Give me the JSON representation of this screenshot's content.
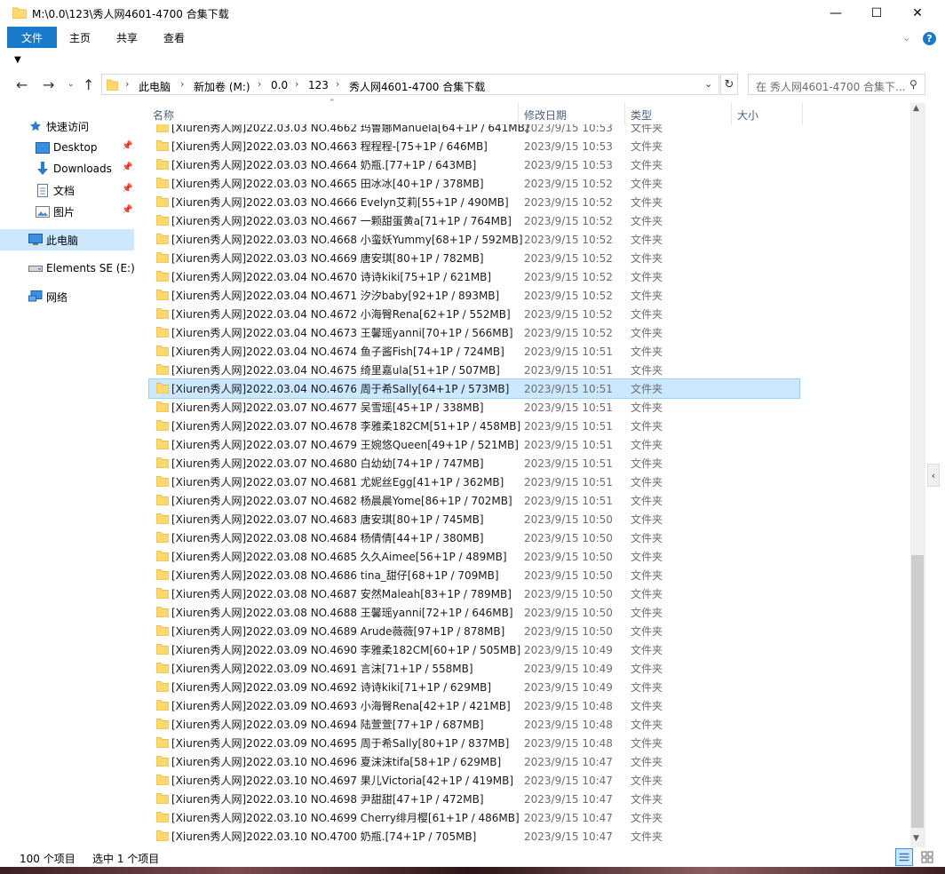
{
  "window": {
    "title": "M:\\0.0\\123\\秀人网4601-4700 合集下载",
    "minimize_glyph": "—",
    "maximize_glyph": "☐",
    "close_glyph": "✕"
  },
  "ribbon": {
    "tabs": [
      "文件",
      "主页",
      "共享",
      "查看"
    ],
    "help": "?"
  },
  "address": {
    "crumbs": [
      "此电脑",
      "新加卷 (M:)",
      "0.0",
      "123",
      "秀人网4601-4700 合集下载"
    ],
    "separator": "›"
  },
  "search": {
    "placeholder": "在 秀人网4601-4700 合集下..."
  },
  "nav": {
    "quick_access": "快速访问",
    "desktop": "Desktop",
    "downloads": "Downloads",
    "documents": "文档",
    "pictures": "图片",
    "this_pc": "此电脑",
    "elements": "Elements SE (E:)",
    "network": "网络"
  },
  "columns": {
    "name": "名称",
    "date": "修改日期",
    "type": "类型",
    "size": "大小"
  },
  "files": [
    {
      "name": "[Xiuren秀人网]2022.03.03 NO.4662 玛鲁娜Manuela[64+1P / 641MB]",
      "date": "2023/9/15 10:53",
      "type": "文件夹"
    },
    {
      "name": "[Xiuren秀人网]2022.03.03 NO.4663 程程程-[75+1P / 646MB]",
      "date": "2023/9/15 10:53",
      "type": "文件夹"
    },
    {
      "name": "[Xiuren秀人网]2022.03.03 NO.4664 奶瓶.[77+1P / 643MB]",
      "date": "2023/9/15 10:53",
      "type": "文件夹"
    },
    {
      "name": "[Xiuren秀人网]2022.03.03 NO.4665 田冰冰[40+1P / 378MB]",
      "date": "2023/9/15 10:52",
      "type": "文件夹"
    },
    {
      "name": "[Xiuren秀人网]2022.03.03 NO.4666 Evelyn艾莉[55+1P / 490MB]",
      "date": "2023/9/15 10:52",
      "type": "文件夹"
    },
    {
      "name": "[Xiuren秀人网]2022.03.03 NO.4667 一颗甜蛋黄a[71+1P / 764MB]",
      "date": "2023/9/15 10:52",
      "type": "文件夹"
    },
    {
      "name": "[Xiuren秀人网]2022.03.03 NO.4668 小蛮妖Yummy[68+1P / 592MB]",
      "date": "2023/9/15 10:52",
      "type": "文件夹"
    },
    {
      "name": "[Xiuren秀人网]2022.03.03 NO.4669 唐安琪[80+1P / 782MB]",
      "date": "2023/9/15 10:52",
      "type": "文件夹"
    },
    {
      "name": "[Xiuren秀人网]2022.03.04 NO.4670 诗诗kiki[75+1P / 621MB]",
      "date": "2023/9/15 10:52",
      "type": "文件夹"
    },
    {
      "name": "[Xiuren秀人网]2022.03.04 NO.4671 汐汐baby[92+1P / 893MB]",
      "date": "2023/9/15 10:52",
      "type": "文件夹"
    },
    {
      "name": "[Xiuren秀人网]2022.03.04 NO.4672 小海臀Rena[62+1P / 552MB]",
      "date": "2023/9/15 10:52",
      "type": "文件夹"
    },
    {
      "name": "[Xiuren秀人网]2022.03.04 NO.4673 王馨瑶yanni[70+1P / 566MB]",
      "date": "2023/9/15 10:52",
      "type": "文件夹"
    },
    {
      "name": "[Xiuren秀人网]2022.03.04 NO.4674 鱼子酱Fish[74+1P / 724MB]",
      "date": "2023/9/15 10:51",
      "type": "文件夹"
    },
    {
      "name": "[Xiuren秀人网]2022.03.04 NO.4675 绮里嘉ula[51+1P / 507MB]",
      "date": "2023/9/15 10:51",
      "type": "文件夹"
    },
    {
      "name": "[Xiuren秀人网]2022.03.04 NO.4676 周于希Sally[64+1P / 573MB]",
      "date": "2023/9/15 10:51",
      "type": "文件夹",
      "selected": true
    },
    {
      "name": "[Xiuren秀人网]2022.03.07 NO.4677 吴雪瑶[45+1P / 338MB]",
      "date": "2023/9/15 10:51",
      "type": "文件夹"
    },
    {
      "name": "[Xiuren秀人网]2022.03.07 NO.4678 李雅柔182CM[51+1P / 458MB]",
      "date": "2023/9/15 10:51",
      "type": "文件夹"
    },
    {
      "name": "[Xiuren秀人网]2022.03.07 NO.4679 王婉悠Queen[49+1P / 521MB]",
      "date": "2023/9/15 10:51",
      "type": "文件夹"
    },
    {
      "name": "[Xiuren秀人网]2022.03.07 NO.4680 白幼幼[74+1P / 747MB]",
      "date": "2023/9/15 10:51",
      "type": "文件夹"
    },
    {
      "name": "[Xiuren秀人网]2022.03.07 NO.4681 尤妮丝Egg[41+1P / 362MB]",
      "date": "2023/9/15 10:51",
      "type": "文件夹"
    },
    {
      "name": "[Xiuren秀人网]2022.03.07 NO.4682 杨晨晨Yome[86+1P / 702MB]",
      "date": "2023/9/15 10:51",
      "type": "文件夹"
    },
    {
      "name": "[Xiuren秀人网]2022.03.07 NO.4683 唐安琪[80+1P / 745MB]",
      "date": "2023/9/15 10:50",
      "type": "文件夹"
    },
    {
      "name": "[Xiuren秀人网]2022.03.08 NO.4684 杨倩倩[44+1P / 380MB]",
      "date": "2023/9/15 10:50",
      "type": "文件夹"
    },
    {
      "name": "[Xiuren秀人网]2022.03.08 NO.4685 久久Aimee[56+1P / 489MB]",
      "date": "2023/9/15 10:50",
      "type": "文件夹"
    },
    {
      "name": "[Xiuren秀人网]2022.03.08 NO.4686 tina_甜仔[68+1P / 709MB]",
      "date": "2023/9/15 10:50",
      "type": "文件夹"
    },
    {
      "name": "[Xiuren秀人网]2022.03.08 NO.4687 安然Maleah[83+1P / 789MB]",
      "date": "2023/9/15 10:50",
      "type": "文件夹"
    },
    {
      "name": "[Xiuren秀人网]2022.03.08 NO.4688 王馨瑶yanni[72+1P / 646MB]",
      "date": "2023/9/15 10:50",
      "type": "文件夹"
    },
    {
      "name": "[Xiuren秀人网]2022.03.09 NO.4689 Arude薇薇[97+1P / 878MB]",
      "date": "2023/9/15 10:50",
      "type": "文件夹"
    },
    {
      "name": "[Xiuren秀人网]2022.03.09 NO.4690 李雅柔182CM[60+1P / 505MB]",
      "date": "2023/9/15 10:49",
      "type": "文件夹"
    },
    {
      "name": "[Xiuren秀人网]2022.03.09 NO.4691 言沫[71+1P / 558MB]",
      "date": "2023/9/15 10:49",
      "type": "文件夹"
    },
    {
      "name": "[Xiuren秀人网]2022.03.09 NO.4692 诗诗kiki[71+1P / 629MB]",
      "date": "2023/9/15 10:49",
      "type": "文件夹"
    },
    {
      "name": "[Xiuren秀人网]2022.03.09 NO.4693 小海臀Rena[42+1P / 421MB]",
      "date": "2023/9/15 10:48",
      "type": "文件夹"
    },
    {
      "name": "[Xiuren秀人网]2022.03.09 NO.4694 陆萱萱[77+1P / 687MB]",
      "date": "2023/9/15 10:48",
      "type": "文件夹"
    },
    {
      "name": "[Xiuren秀人网]2022.03.09 NO.4695 周于希Sally[80+1P / 837MB]",
      "date": "2023/9/15 10:48",
      "type": "文件夹"
    },
    {
      "name": "[Xiuren秀人网]2022.03.10 NO.4696 夏沫沫tifa[58+1P / 629MB]",
      "date": "2023/9/15 10:47",
      "type": "文件夹"
    },
    {
      "name": "[Xiuren秀人网]2022.03.10 NO.4697 果儿Victoria[42+1P / 419MB]",
      "date": "2023/9/15 10:47",
      "type": "文件夹"
    },
    {
      "name": "[Xiuren秀人网]2022.03.10 NO.4698 尹甜甜[47+1P / 472MB]",
      "date": "2023/9/15 10:47",
      "type": "文件夹"
    },
    {
      "name": "[Xiuren秀人网]2022.03.10 NO.4699 Cherry绯月樱[61+1P / 486MB]",
      "date": "2023/9/15 10:47",
      "type": "文件夹"
    },
    {
      "name": "[Xiuren秀人网]2022.03.10 NO.4700 奶瓶.[74+1P / 705MB]",
      "date": "2023/9/15 10:47",
      "type": "文件夹"
    }
  ],
  "status": {
    "item_count": "100 个项目",
    "selected": "选中 1 个项目"
  },
  "colors": {
    "accent": "#1979ca",
    "selection": "#cce8ff",
    "folder": "#ffd86e"
  },
  "icons": {
    "folder": "folder-icon",
    "star": "star-icon",
    "desktop": "desktop-icon",
    "downloads": "download-arrow-icon",
    "documents": "document-icon",
    "pictures": "picture-icon",
    "this_pc": "monitor-icon",
    "drive": "drive-icon",
    "network": "network-icon"
  }
}
